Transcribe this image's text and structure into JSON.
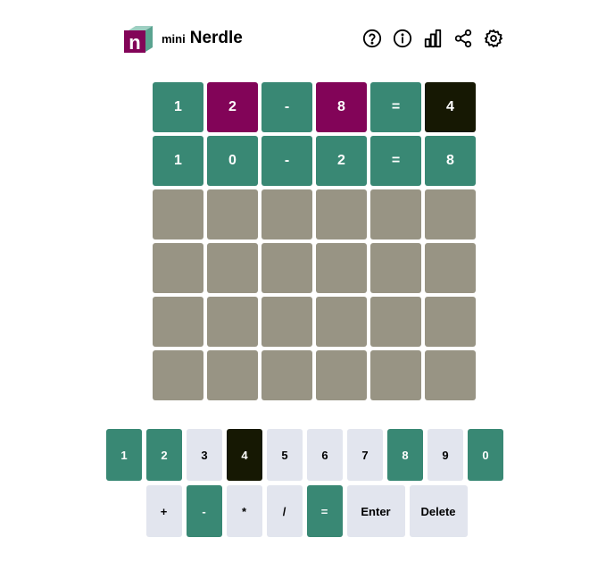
{
  "header": {
    "mini_label": "mini",
    "title": "Nerdle",
    "logo_letter": "n",
    "icons": [
      "help-icon",
      "info-icon",
      "stats-icon",
      "share-icon",
      "settings-icon"
    ]
  },
  "colors": {
    "correct": "#398874",
    "misplaced": "#820458",
    "absent": "#161803",
    "empty": "#989484",
    "key_default": "#e2e5ee"
  },
  "board": {
    "rows": [
      [
        {
          "v": "1",
          "s": "green"
        },
        {
          "v": "2",
          "s": "purple"
        },
        {
          "v": "-",
          "s": "green"
        },
        {
          "v": "8",
          "s": "purple"
        },
        {
          "v": "=",
          "s": "green"
        },
        {
          "v": "4",
          "s": "black"
        }
      ],
      [
        {
          "v": "1",
          "s": "green"
        },
        {
          "v": "0",
          "s": "green"
        },
        {
          "v": "-",
          "s": "green"
        },
        {
          "v": "2",
          "s": "green"
        },
        {
          "v": "=",
          "s": "green"
        },
        {
          "v": "8",
          "s": "green"
        }
      ],
      [
        {
          "v": "",
          "s": "empty"
        },
        {
          "v": "",
          "s": "empty"
        },
        {
          "v": "",
          "s": "empty"
        },
        {
          "v": "",
          "s": "empty"
        },
        {
          "v": "",
          "s": "empty"
        },
        {
          "v": "",
          "s": "empty"
        }
      ],
      [
        {
          "v": "",
          "s": "empty"
        },
        {
          "v": "",
          "s": "empty"
        },
        {
          "v": "",
          "s": "empty"
        },
        {
          "v": "",
          "s": "empty"
        },
        {
          "v": "",
          "s": "empty"
        },
        {
          "v": "",
          "s": "empty"
        }
      ],
      [
        {
          "v": "",
          "s": "empty"
        },
        {
          "v": "",
          "s": "empty"
        },
        {
          "v": "",
          "s": "empty"
        },
        {
          "v": "",
          "s": "empty"
        },
        {
          "v": "",
          "s": "empty"
        },
        {
          "v": "",
          "s": "empty"
        }
      ],
      [
        {
          "v": "",
          "s": "empty"
        },
        {
          "v": "",
          "s": "empty"
        },
        {
          "v": "",
          "s": "empty"
        },
        {
          "v": "",
          "s": "empty"
        },
        {
          "v": "",
          "s": "empty"
        },
        {
          "v": "",
          "s": "empty"
        }
      ]
    ]
  },
  "keyboard": {
    "row1": [
      {
        "label": "1",
        "s": "green"
      },
      {
        "label": "2",
        "s": "green"
      },
      {
        "label": "3",
        "s": "default"
      },
      {
        "label": "4",
        "s": "black"
      },
      {
        "label": "5",
        "s": "default"
      },
      {
        "label": "6",
        "s": "default"
      },
      {
        "label": "7",
        "s": "default"
      },
      {
        "label": "8",
        "s": "green"
      },
      {
        "label": "9",
        "s": "default"
      },
      {
        "label": "0",
        "s": "green"
      }
    ],
    "row2": [
      {
        "label": "+",
        "s": "default"
      },
      {
        "label": "-",
        "s": "green"
      },
      {
        "label": "*",
        "s": "default"
      },
      {
        "label": "/",
        "s": "default"
      },
      {
        "label": "=",
        "s": "green"
      },
      {
        "label": "Enter",
        "s": "default",
        "wide": true
      },
      {
        "label": "Delete",
        "s": "default",
        "wide": true
      }
    ]
  }
}
